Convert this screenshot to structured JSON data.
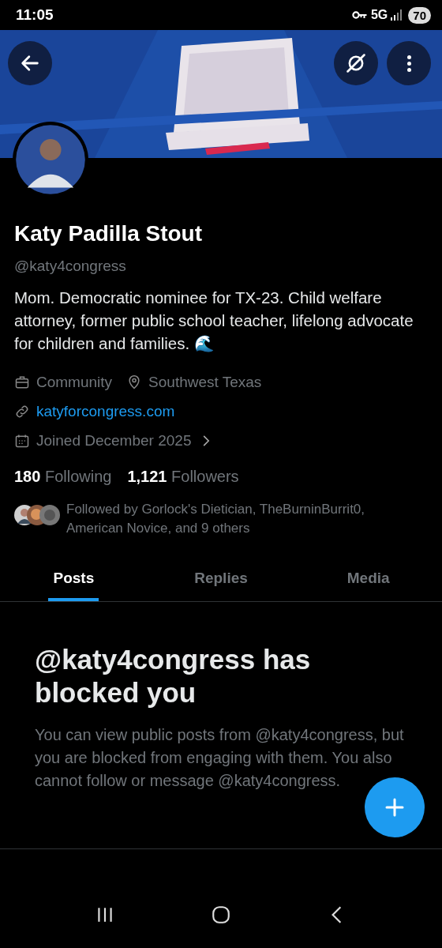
{
  "status_bar": {
    "time": "11:05",
    "network": "5G",
    "battery": "70"
  },
  "profile": {
    "name": "Katy Padilla Stout",
    "handle": "@katy4congress",
    "bio": "Mom. Democratic nominee for TX-23. Child welfare attorney, former public school teacher, lifelong advocate for children and families. 🌊",
    "meta_rows": [
      [
        {
          "kind": "category",
          "text": "Community"
        },
        {
          "kind": "location",
          "text": "Southwest Texas"
        }
      ],
      [
        {
          "kind": "link",
          "text": "katyforcongress.com"
        }
      ],
      [
        {
          "kind": "joined",
          "text": "Joined December 2025"
        }
      ]
    ],
    "stats": [
      {
        "count": "180",
        "label": "Following"
      },
      {
        "count": "1,121",
        "label": "Followers"
      }
    ],
    "followed_by": "Followed by Gorlock's Dietician, TheBurninBurrit0, American Novice, and 9 others"
  },
  "tabs": [
    {
      "label": "Posts",
      "selected": true
    },
    {
      "label": "Replies",
      "selected": false
    },
    {
      "label": "Media",
      "selected": false
    }
  ],
  "blocked_notice": {
    "title": "@katy4congress has blocked you",
    "body": "You can view public posts from @katy4congress, but you are blocked from engaging with them. You also cannot follow or message @katy4congress."
  }
}
